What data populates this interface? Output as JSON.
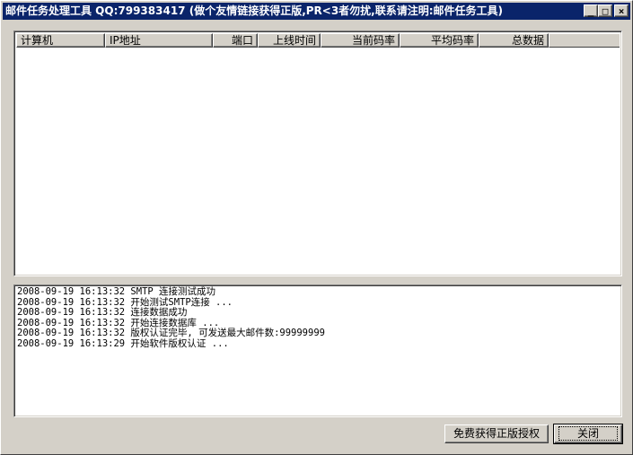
{
  "window": {
    "title": "邮件任务处理工具 QQ:799383417 (做个友情链接获得正版,PR<3者勿扰,联系请注明:邮件任务工具)",
    "controls": {
      "minimize": "_",
      "maximize": "□",
      "close": "×"
    }
  },
  "list": {
    "columns": [
      {
        "label": "计算机",
        "align": "left"
      },
      {
        "label": "IP地址",
        "align": "left"
      },
      {
        "label": "端口",
        "align": "right"
      },
      {
        "label": "上线时间",
        "align": "right"
      },
      {
        "label": "当前码率",
        "align": "right"
      },
      {
        "label": "平均码率",
        "align": "right"
      },
      {
        "label": "总数据",
        "align": "right"
      }
    ]
  },
  "log": {
    "lines": [
      "2008-09-19 16:13:32 SMTP 连接测试成功",
      "2008-09-19 16:13:32 开始测试SMTP连接 ...",
      "2008-09-19 16:13:32 连接数据成功",
      "2008-09-19 16:13:32 开始连接数据库 ...",
      "2008-09-19 16:13:32 版权认证完毕, 可发送最大邮件数:99999999",
      "2008-09-19 16:13:29 开始软件版权认证 ..."
    ]
  },
  "buttons": {
    "free_license": "免费获得正版授权",
    "close": "关闭"
  }
}
